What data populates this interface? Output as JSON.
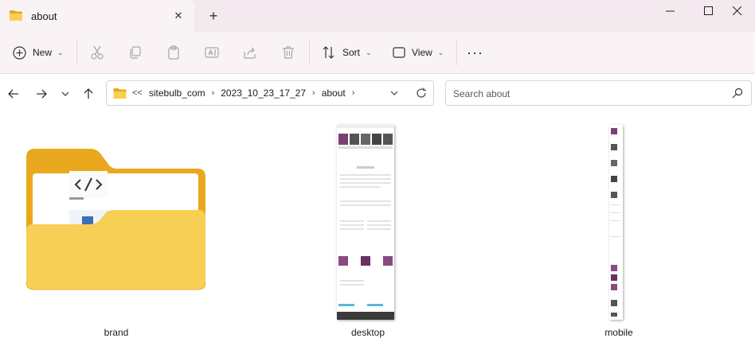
{
  "window": {
    "tab_title": "about",
    "new_tab_symbol": "+",
    "close_tab_symbol": "✕"
  },
  "toolbar": {
    "new_label": "New",
    "sort_label": "Sort",
    "view_label": "View",
    "more_symbol": "···"
  },
  "address_bar": {
    "overflow_symbol": "<<",
    "crumbs": [
      "sitebulb_com",
      "2023_10_23_17_27",
      "about"
    ],
    "separator": "›"
  },
  "search": {
    "placeholder": "Search about"
  },
  "items": [
    {
      "label": "brand",
      "type": "folder"
    },
    {
      "label": "desktop",
      "type": "image"
    },
    {
      "label": "mobile",
      "type": "image"
    }
  ],
  "colors": {
    "titlebar_bg": "#f3e9ee",
    "toolbar_bg": "#f9f3f5",
    "folder_yellow": "#f6c23e",
    "brand_purple": "#7b3f73"
  },
  "icons": {
    "cut": "scissors-icon",
    "copy": "copy-icon",
    "paste": "clipboard-icon",
    "rename": "rename-icon",
    "share": "share-icon",
    "delete": "trash-icon"
  }
}
